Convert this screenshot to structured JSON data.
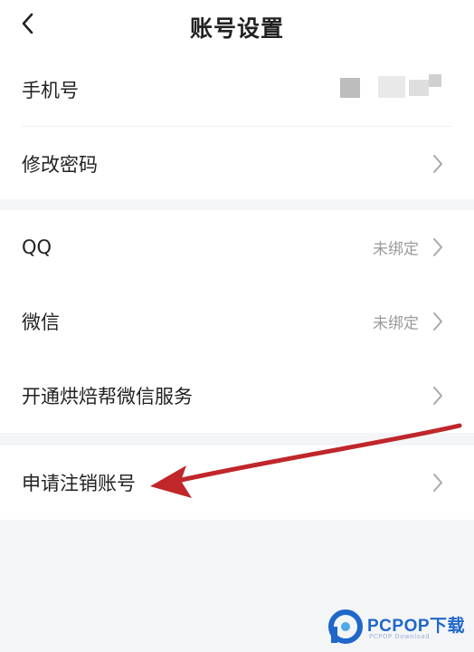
{
  "header": {
    "title": "账号设置",
    "back_icon": "chevron-left-icon"
  },
  "group1": {
    "phone_label": "手机号",
    "password_label": "修改密码"
  },
  "group2": {
    "qq_label": "QQ",
    "qq_status": "未绑定",
    "wechat_label": "微信",
    "wechat_status": "未绑定",
    "service_label": "开通烘焙帮微信服务"
  },
  "group3": {
    "cancel_account_label": "申请注销账号"
  },
  "colors": {
    "background": "#f4f5f7",
    "card": "#ffffff",
    "annotation_arrow": "#c0262a",
    "watermark_blue": "#1f67c9"
  },
  "watermark": {
    "brand": "PCPOP下载",
    "sub": "PCPOP Download"
  }
}
